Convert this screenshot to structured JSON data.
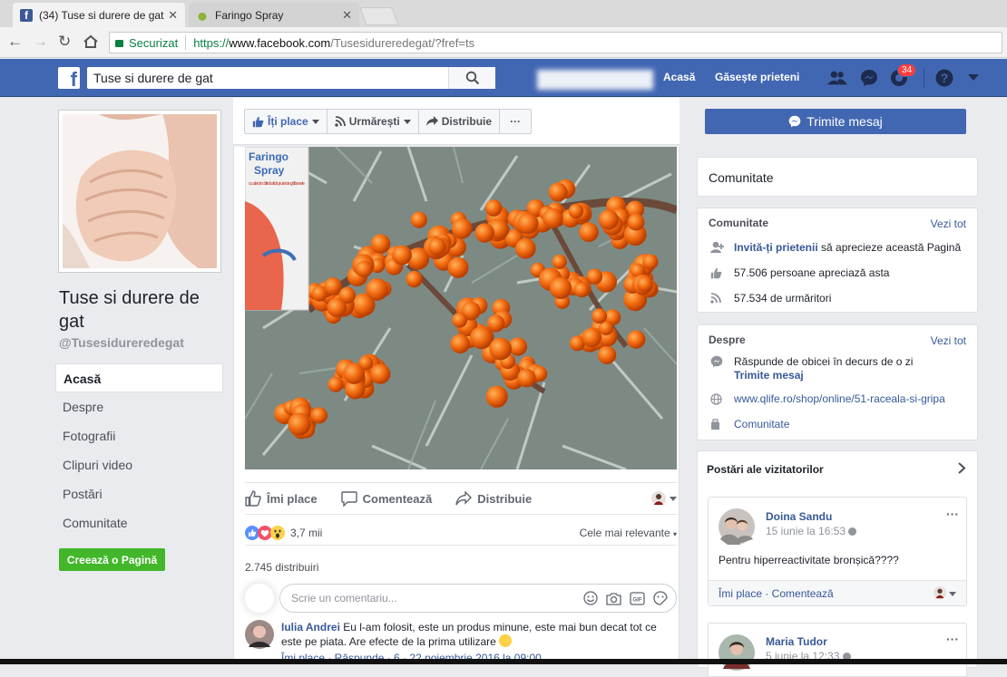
{
  "browser": {
    "tabs": [
      {
        "title": "(34) Tuse si durere de gat",
        "close": "✕"
      },
      {
        "title": "Faringo Spray",
        "close": "✕"
      }
    ],
    "secure_label": "Securizat",
    "url_scheme": "https://",
    "url_host": "www.facebook.com",
    "url_path": "/Tusesidureredegat/?fref=ts"
  },
  "header": {
    "search_value": "Tuse si durere de gat",
    "home": "Acasă",
    "find_friends": "Găsește prieteni",
    "notif_count": "34"
  },
  "page": {
    "name": "Tuse si durere de gat",
    "handle": "@Tusesidureredegat",
    "nav": [
      "Acasă",
      "Despre",
      "Fotografii",
      "Clipuri video",
      "Postări",
      "Comunitate"
    ],
    "create_page": "Creează o Pagină"
  },
  "actions": {
    "like": "Îți place",
    "follow": "Urmărești",
    "share": "Distribuie",
    "more": "···",
    "message": "Trimite mesaj"
  },
  "post": {
    "product_name_line1": "Faringo",
    "product_name_line2": "Spray",
    "product_sub": "cu ulei de cătină albă și ulei de gălbenele",
    "like": "Îmi place",
    "comment": "Comentează",
    "share": "Distribuie",
    "reaction_count": "3,7 mii",
    "most_relevant": "Cele mai relevante",
    "shares": "2.745 distribuiri",
    "comment_placeholder": "Scrie un comentariu...",
    "comment1_author": "Iulia Andrei",
    "comment1_text": "Eu l-am folosit, este un produs minune, este mai bun decat tot ce este pe piata. Are efecte de la prima utilizare",
    "comment1_meta": "Îmi place · Răspunde · 6 · 22 noiembrie 2016 la 09:00"
  },
  "right": {
    "community_title": "Comunitate",
    "community_header": "Comunitate",
    "see_all": "Vezi tot",
    "invite_link": "Invită-ți prietenii",
    "invite_rest": " să aprecieze această Pagină",
    "likes": "57.506 persoane apreciază asta",
    "followers": "57.534 de urmăritori",
    "about_header": "Despre",
    "response": "Răspunde de obicei în decurs de o zi",
    "send_message": "Trimite mesaj",
    "website": "www.qlife.ro/shop/online/51-raceala-si-gripa",
    "category": "Comunitate",
    "visitor_posts": "Postări ale vizitatorilor",
    "visitor1_name": "Doina Sandu",
    "visitor1_date": "15 iunie la 16:53",
    "visitor1_text": "Pentru hiperreactivitate bronșică????",
    "visitor1_actions": "Îmi place · Comentează",
    "visitor2_name": "Maria Tudor",
    "visitor2_date": "5 iunie la 12:33"
  },
  "colors": {
    "fb_blue": "#4267b2",
    "link": "#385898",
    "green": "#42b72a",
    "berry": "#f26a10"
  }
}
